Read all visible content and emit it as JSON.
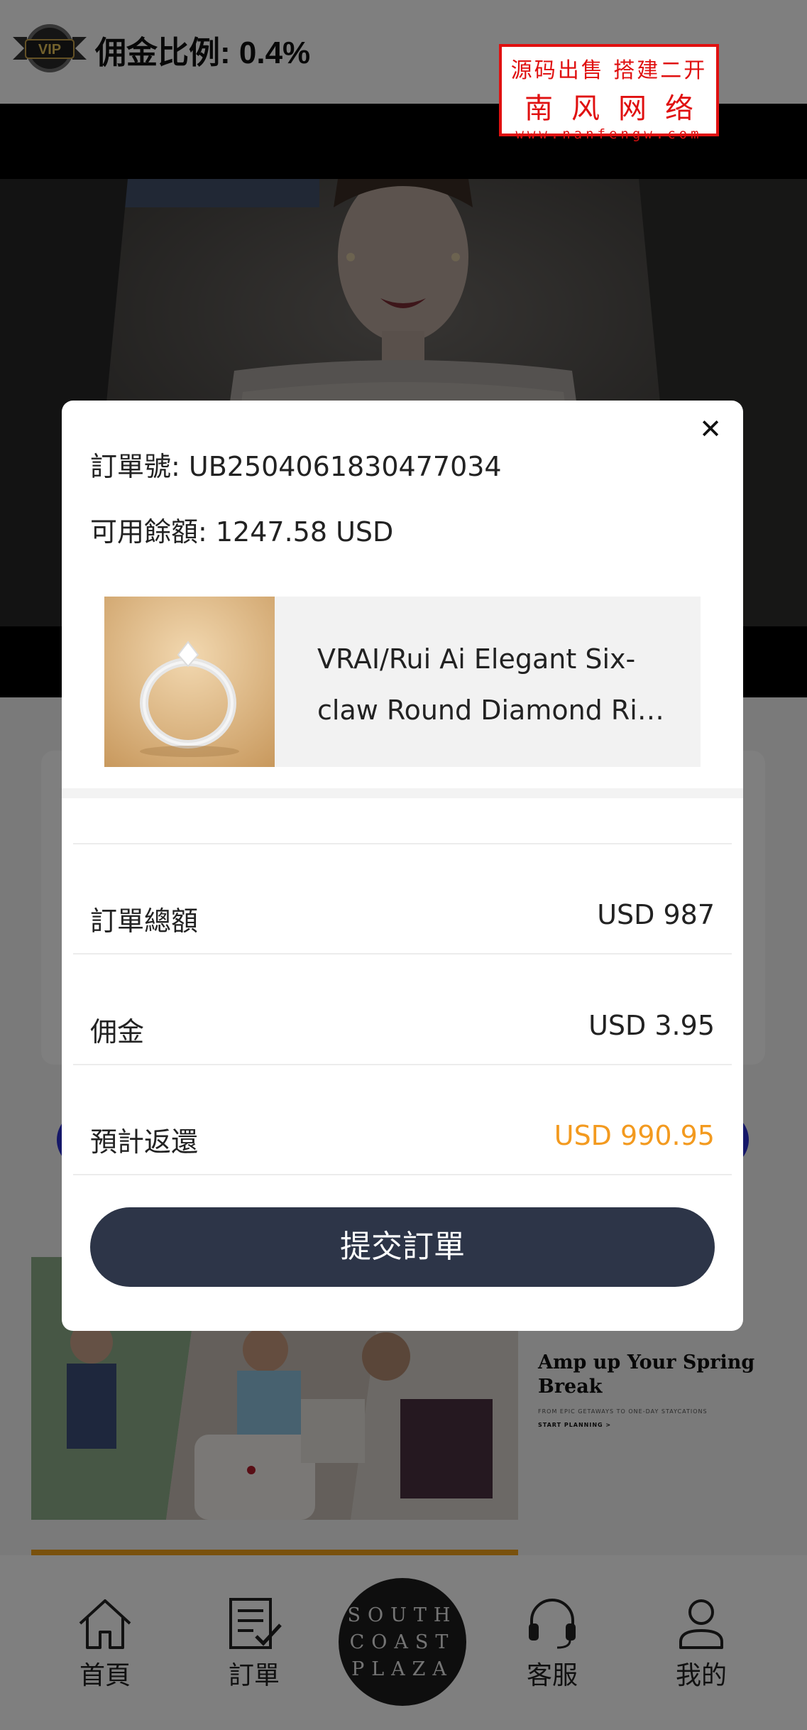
{
  "header": {
    "vip_label": "VIP",
    "commission_text": "佣金比例: 0.4%"
  },
  "watermark": {
    "line1": "源码出售 搭建二开",
    "line2": "南风网络",
    "line3": "www.nanfengw.com"
  },
  "promo": {
    "title": "Amp up Your Spring Break",
    "subtitle": "FROM EPIC GETAWAYS TO ONE-DAY STAYCATIONS",
    "link": "START PLANNING >"
  },
  "tabbar": {
    "items": [
      {
        "label": "首頁",
        "icon": "home-icon"
      },
      {
        "label": "訂單",
        "icon": "order-list-icon"
      },
      {
        "label": "客服",
        "icon": "headset-icon"
      },
      {
        "label": "我的",
        "icon": "user-icon"
      }
    ],
    "center_logo": {
      "line1": "SOUTH",
      "line2": "COAST",
      "line3": "PLAZA"
    }
  },
  "modal": {
    "close_icon": "close-icon",
    "order_no": "訂單號: UB2504061830477034",
    "balance": "可用餘額: 1247.58 USD",
    "product": {
      "name_line1": "VRAI/Rui Ai Elegant Six-",
      "name_line2": "claw Round Diamond Rin..."
    },
    "summary": [
      {
        "label": "訂單總額",
        "value": "USD 987"
      },
      {
        "label": "佣金",
        "value": "USD 3.95"
      },
      {
        "label": "預計返還",
        "value": "USD 990.95"
      }
    ],
    "submit_label": "提交訂單"
  },
  "colors": {
    "accent_orange": "#f39a1f",
    "submit_button": "#2d3548",
    "watermark_red": "#e01010"
  }
}
